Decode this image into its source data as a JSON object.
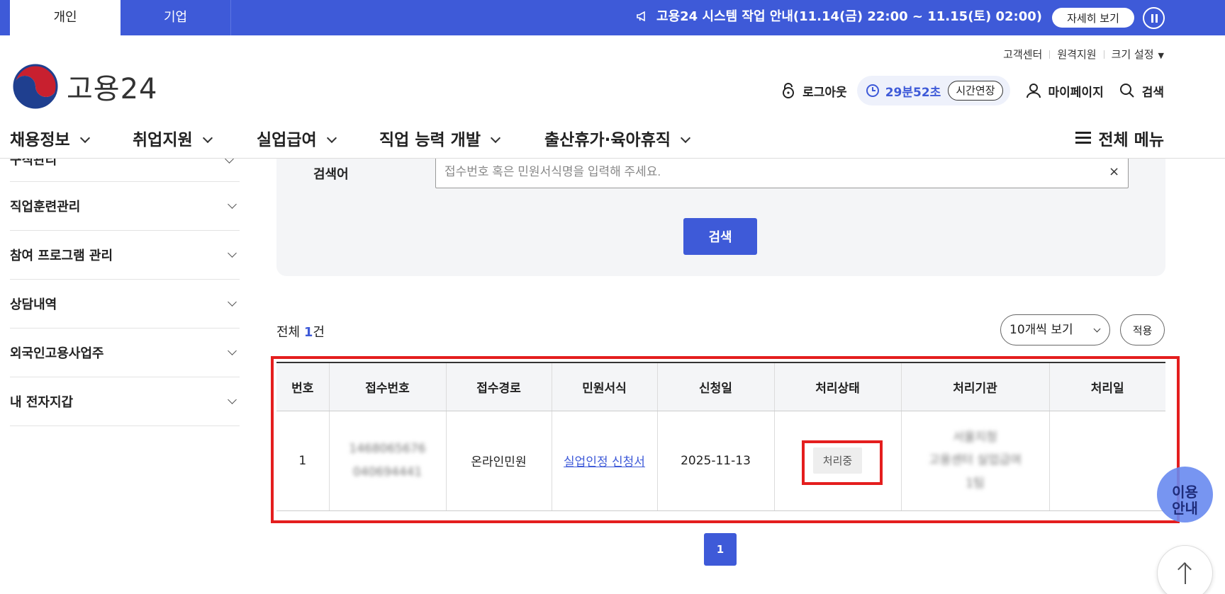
{
  "topbar": {
    "tabs": [
      "개인",
      "기업"
    ],
    "notice": "고용24 시스템 작업 안내(11.14(금) 22:00 ~ 11.15(토) 02:00)",
    "detail_label": "자세히 보기"
  },
  "utility": {
    "customer_center": "고객센터",
    "remote_support": "원격지원",
    "size_setting": "크기 설정"
  },
  "logo": {
    "name": "고용24"
  },
  "header": {
    "logout": "로그아웃",
    "timer": "29분52초",
    "extend": "시간연장",
    "mypage": "마이페이지",
    "search": "검색"
  },
  "nav": {
    "items": [
      "채용정보",
      "취업지원",
      "실업급여",
      "직업 능력 개발",
      "출산휴가·육아휴직"
    ],
    "all_menu": "전체 메뉴"
  },
  "sidebar": {
    "partial_item": "구직관리",
    "items": [
      "직업훈련관리",
      "참여 프로그램 관리",
      "상담내역",
      "외국인고용사업주",
      "내 전자지갑"
    ]
  },
  "search": {
    "label": "검색어",
    "placeholder": "접수번호 혹은 민원서식명을 입력해 주세요.",
    "clear": "×",
    "button": "검색"
  },
  "results": {
    "total_prefix": "전체 ",
    "total_count": "1",
    "total_suffix": "건",
    "page_size": "10개씩 보기",
    "apply": "적용"
  },
  "table": {
    "headers": [
      "번호",
      "접수번호",
      "접수경로",
      "민원서식",
      "신청일",
      "처리상태",
      "처리기관",
      "처리일"
    ],
    "rows": [
      {
        "no": "1",
        "receipt_line1": "1468065676",
        "receipt_line2": "040694441",
        "route": "온라인민원",
        "form": "실업인정 신청서",
        "date": "2025-11-13",
        "status": "처리중",
        "agency_line1": "서울지청",
        "agency_line2": "고용센터 실업급여",
        "agency_line3": "1팀",
        "processed": ""
      }
    ]
  },
  "pagination": {
    "current": "1"
  },
  "floating": {
    "guide_line1": "이용",
    "guide_line2": "안내"
  },
  "colors": {
    "brand": "#3e5ad8",
    "highlight": "#e41e1e"
  }
}
